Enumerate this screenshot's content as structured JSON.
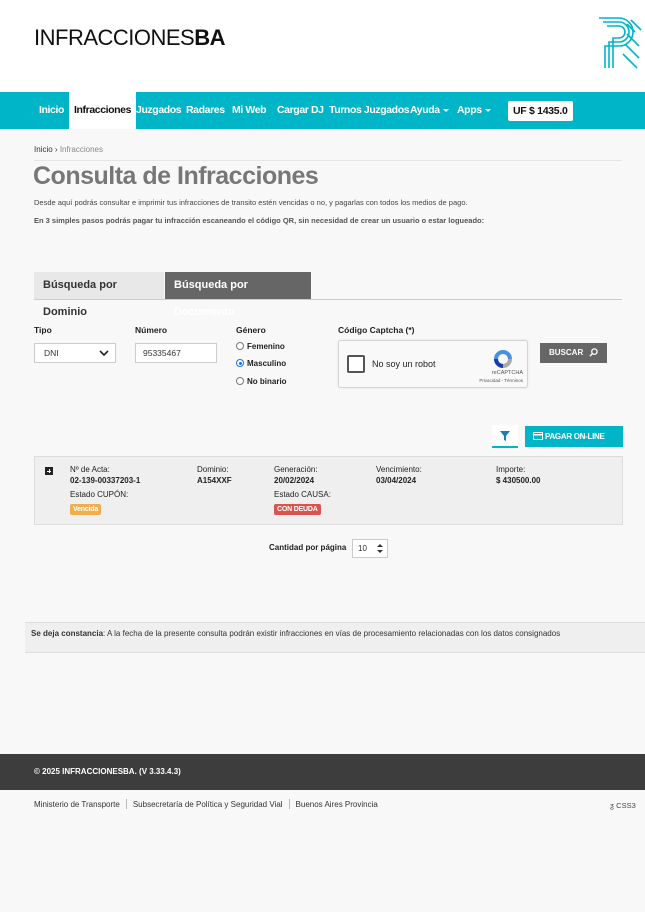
{
  "header": {
    "logo_light": "INFRACCIONES",
    "logo_bold": "BA",
    "brand_mark_icon": "ba-pattern-logo"
  },
  "nav": {
    "items": [
      {
        "label": "Inicio"
      },
      {
        "label": "Infracciones"
      },
      {
        "label": "Juzgados"
      },
      {
        "label": "Radares"
      },
      {
        "label": "Mi Web"
      },
      {
        "label": "Cargar DJ"
      },
      {
        "label": "Turnos Juzgados"
      },
      {
        "label": "Ayuda"
      },
      {
        "label": "Apps"
      }
    ],
    "uf_badge": "UF $ 1435.0",
    "accent": "#00b5c8"
  },
  "breadcrumb": {
    "home": "Inicio",
    "separator": "›",
    "current": "Infracciones"
  },
  "page": {
    "title": "Consulta de Infracciones",
    "desc1": "Desde aquí podrás consultar e imprimir tus infracciones de transito estén vencidas o no, y pagarlas con todos los medios de pago.",
    "desc2": "En 3 simples pasos podrás pagar tu infracción escaneando el código QR, sin necesidad de crear un usuario o estar logueado:"
  },
  "tabs": [
    {
      "label": "Búsqueda por Dominio",
      "active": false
    },
    {
      "label": "Búsqueda por Documento",
      "active": true
    }
  ],
  "form": {
    "tipo_label": "Tipo",
    "tipo_value": "DNI",
    "numero_label": "Número",
    "numero_value": "95335467",
    "genero_label": "Género",
    "genero_options": [
      "Femenino",
      "Masculino",
      "No binario"
    ],
    "genero_selected": "Masculino",
    "captcha_label": "Código Captcha (*)",
    "captcha_text": "No soy un robot",
    "captcha_brand": "reCAPTCHA",
    "captcha_links": "Privacidad - Términos",
    "buscar_label": "BUSCAR"
  },
  "actions": {
    "filter_icon": "filter-icon",
    "pagar_label": "PAGAR ON-LINE"
  },
  "result": {
    "acta_label": "Nº de Acta:",
    "acta_value": "02-139-00337203-1",
    "dominio_label": "Dominio:",
    "dominio_value": "A154XXF",
    "generacion_label": "Generación:",
    "generacion_value": "20/02/2024",
    "vencimiento_label": "Vencimiento:",
    "vencimiento_value": "03/04/2024",
    "importe_label": "Importe:",
    "importe_value": "$ 430500.00",
    "cupon_label": "Estado CUPÓN:",
    "cupon_value": "Vencida",
    "causa_label": "Estado CAUSA:",
    "causa_value": "CON DEUDA"
  },
  "pagination": {
    "label": "Cantidad por página",
    "value": "10"
  },
  "notice": {
    "bold": "Se deja constancia",
    "text": ": A la fecha de la presente consulta podrán existir infracciones en vías de procesamiento relacionadas con los datos consignados"
  },
  "footer": {
    "copyright": "© 2025 INFRACCIONESBA. (V 3.33.4.3)",
    "links": [
      "Ministerio de Transporte",
      "Subsecretaría de Política y Seguridad Vial",
      "Buenos Aires Provincia"
    ],
    "css3": "CSS3"
  }
}
